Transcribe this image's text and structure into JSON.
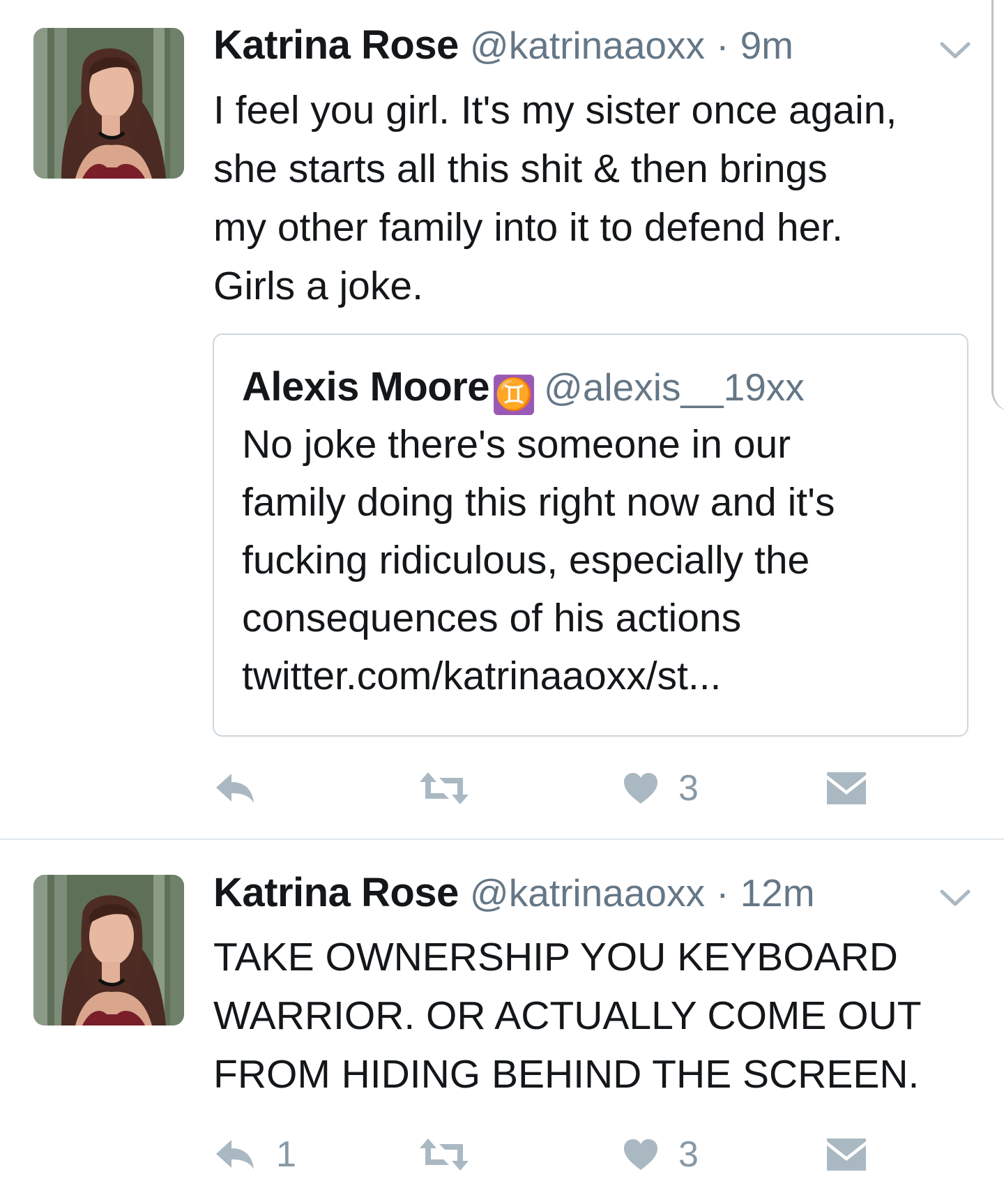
{
  "tweets": [
    {
      "name": "Katrina Rose",
      "handle": "@katrinaaoxx",
      "dot": "·",
      "time": "9m",
      "text": "I feel you girl. It's my sister once again,\nshe starts all this shit & then brings\nmy other family into it to defend her.\nGirls a joke.",
      "quoted": {
        "name": "Alexis Moore",
        "emoji": "♊",
        "handle": "@alexis__19xx",
        "text": "No joke there's someone in our\nfamily doing this right now and it's\nfucking ridiculous, especially the\nconsequences of his actions\ntwitter.com/katrinaaoxx/st..."
      },
      "reply_count": "",
      "like_count": "3"
    },
    {
      "name": "Katrina Rose",
      "handle": "@katrinaaoxx",
      "dot": "·",
      "time": "12m",
      "text": "TAKE OWNERSHIP YOU KEYBOARD\nWARRIOR. OR ACTUALLY COME OUT\nFROM HIDING BEHIND THE SCREEN.",
      "reply_count": "1",
      "like_count": "3"
    }
  ],
  "icons": {
    "reply": "reply-icon",
    "retweet": "retweet-icon",
    "like": "heart-icon",
    "dm": "envelope-icon",
    "caret": "chevron-down-icon",
    "avatar": "avatar"
  },
  "colors": {
    "text": "#14171a",
    "muted": "#657786",
    "action": "#aab8c2",
    "border": "#ccd6dd",
    "emoji_bg": "#9b59b6"
  }
}
